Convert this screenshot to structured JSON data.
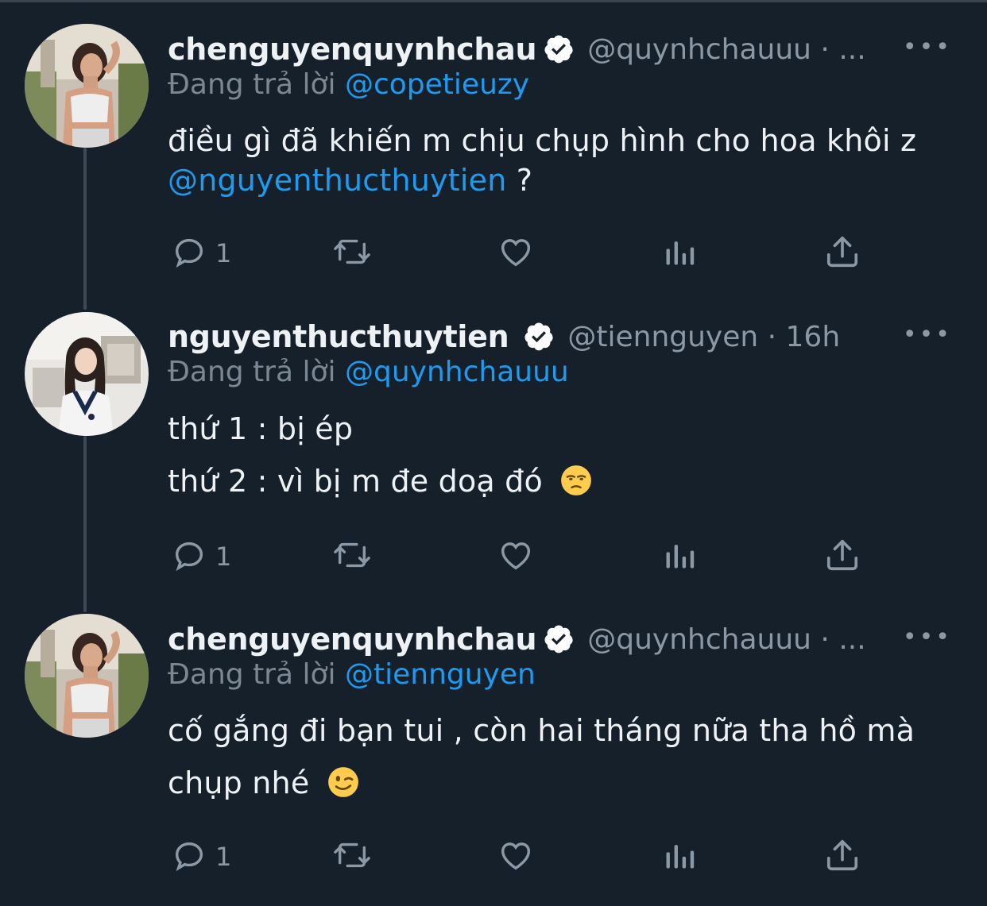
{
  "colors": {
    "background": "#15202b",
    "link": "#1d9bf0",
    "secondary": "#8b98a5",
    "text": "#eef2f5",
    "verified": "#ffffff"
  },
  "replying_prefix": "Đang trả lời",
  "tweets": [
    {
      "display_name": "chenguyenquynhchau",
      "handle_time": "@quynhchauuu · ...",
      "reply_to": "@copetieuzy",
      "body_line1": "điều gì đã khiến m chịu chụp hình cho hoa khôi z",
      "body_line2_mention": "@nguyenthucthuytien",
      "body_line2_rest": " ?",
      "reply_count": "1"
    },
    {
      "display_name": "nguyenthucthuytien",
      "handle_time": "@tiennguyen · 16h",
      "reply_to": "@quynhchauuu",
      "body_line1": "thứ 1 : bị ép",
      "body_line2": "thứ 2 : vì bị m đe doạ đó",
      "emoji": "unamused-face",
      "reply_count": "1"
    },
    {
      "display_name": "chenguyenquynhchau",
      "handle_time": "@quynhchauuu · ...",
      "reply_to": "@tiennguyen",
      "body_line1": "cố gắng đi bạn tui , còn hai tháng nữa tha hồ mà",
      "body_line2": "chụp nhé",
      "emoji": "winking-face",
      "reply_count": "1"
    }
  ],
  "icons": {
    "more": "more-dots-icon",
    "reply": "reply-bubble-icon",
    "retweet": "retweet-icon",
    "like": "heart-icon",
    "analytics": "analytics-bars-icon",
    "share": "share-upload-icon",
    "verified": "verified-badge-icon"
  }
}
